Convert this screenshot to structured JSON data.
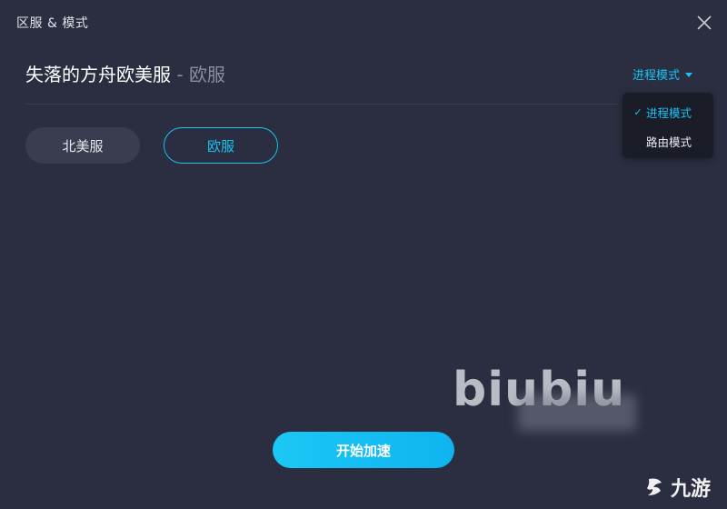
{
  "window": {
    "title": "区服 & 模式"
  },
  "header": {
    "game_name": "失落的方舟欧美服",
    "separator": " - ",
    "selected_region": "欧服"
  },
  "mode": {
    "current_label": "进程模式",
    "options": [
      {
        "label": "进程模式",
        "checked": true
      },
      {
        "label": "路由模式",
        "checked": false
      }
    ],
    "check_glyph": "✓"
  },
  "regions": [
    {
      "label": "北美服",
      "selected": false
    },
    {
      "label": "欧服",
      "selected": true
    }
  ],
  "actions": {
    "start_label": "开始加速"
  },
  "watermarks": {
    "biubiu": "biubiu",
    "brand": "九游"
  },
  "colors": {
    "background": "#2b2e40",
    "accent": "#19c3f2",
    "dropdown_bg": "#1a1c28",
    "pill_bg": "#3a3d50"
  }
}
